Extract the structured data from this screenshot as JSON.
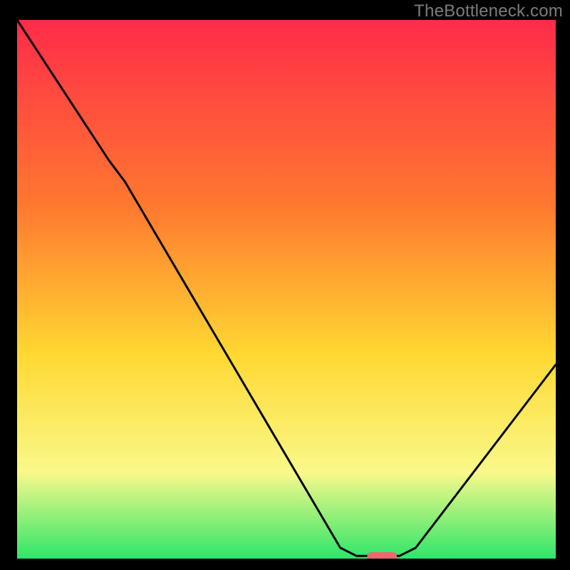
{
  "watermark": "TheBottleneck.com",
  "colors": {
    "background": "#000000",
    "gradient_top": "#ff2b4a",
    "gradient_upper": "#ff7a2f",
    "gradient_mid": "#ffd832",
    "gradient_lower": "#f9f98a",
    "gradient_bottom": "#2ee66a",
    "curve": "#000000",
    "marker": "#e76a6f"
  },
  "chart_data": {
    "type": "line",
    "title": "",
    "xlabel": "",
    "ylabel": "",
    "xlim": [
      0,
      100
    ],
    "ylim": [
      0,
      100
    ],
    "gradient_stops": [
      {
        "offset": 0.0,
        "key": "gradient_top"
      },
      {
        "offset": 0.35,
        "key": "gradient_upper"
      },
      {
        "offset": 0.62,
        "key": "gradient_mid"
      },
      {
        "offset": 0.84,
        "key": "gradient_lower"
      },
      {
        "offset": 1.0,
        "key": "gradient_bottom"
      }
    ],
    "curve": [
      {
        "x": 0.0,
        "y": 100.0
      },
      {
        "x": 17.0,
        "y": 74.0
      },
      {
        "x": 20.0,
        "y": 70.0
      },
      {
        "x": 60.0,
        "y": 2.0
      },
      {
        "x": 63.0,
        "y": 0.5
      },
      {
        "x": 71.0,
        "y": 0.5
      },
      {
        "x": 74.0,
        "y": 2.0
      },
      {
        "x": 100.0,
        "y": 36.0
      }
    ],
    "marker": {
      "x_start": 65.0,
      "x_end": 70.5,
      "y": 0.4
    }
  }
}
